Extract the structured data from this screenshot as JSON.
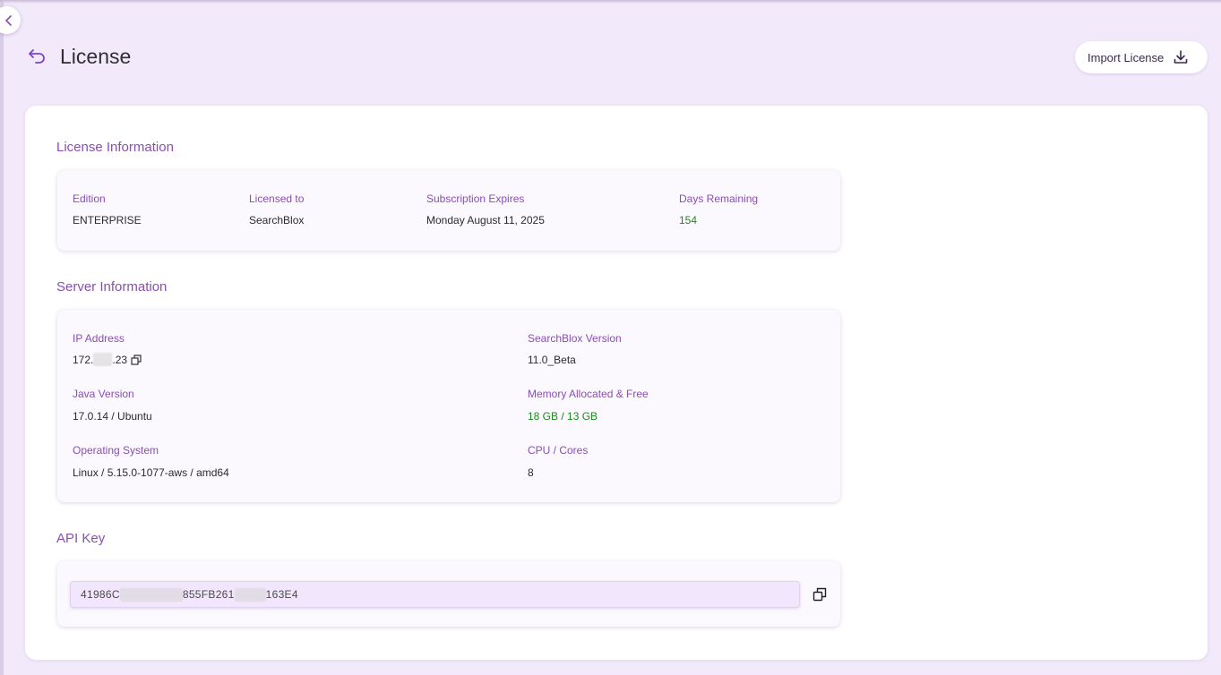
{
  "header": {
    "title": "License",
    "import_button_label": "Import License"
  },
  "icons": {
    "collapse": "chevron-left-icon",
    "back": "undo-arrow-icon",
    "import": "download-icon",
    "copy": "copy-icon"
  },
  "colors": {
    "background": "#f2e9fb",
    "accent": "#8a4fb0",
    "positive": "#1e8a1e"
  },
  "license_info": {
    "section_title": "License Information",
    "edition_label": "Edition",
    "edition_value": "ENTERPRISE",
    "licensed_to_label": "Licensed to",
    "licensed_to_value": "SearchBlox",
    "expires_label": "Subscription Expires",
    "expires_value": "Monday August 11, 2025",
    "days_label": "Days Remaining",
    "days_value": "154"
  },
  "server_info": {
    "section_title": "Server Information",
    "ip_label": "IP Address",
    "ip_prefix": "172.",
    "ip_suffix": ".23",
    "version_label": "SearchBlox Version",
    "version_value": "11.0_Beta",
    "java_label": "Java Version",
    "java_value": "17.0.14 / Ubuntu",
    "memory_label": "Memory Allocated & Free",
    "memory_value": "18 GB / 13 GB",
    "os_label": "Operating System",
    "os_value": "Linux / 5.15.0-1077-aws / amd64",
    "cpu_label": "CPU / Cores",
    "cpu_value": "8"
  },
  "api_key": {
    "section_title": "API Key",
    "part1": "41986C",
    "part2": "855FB261",
    "part3": "163E4"
  }
}
